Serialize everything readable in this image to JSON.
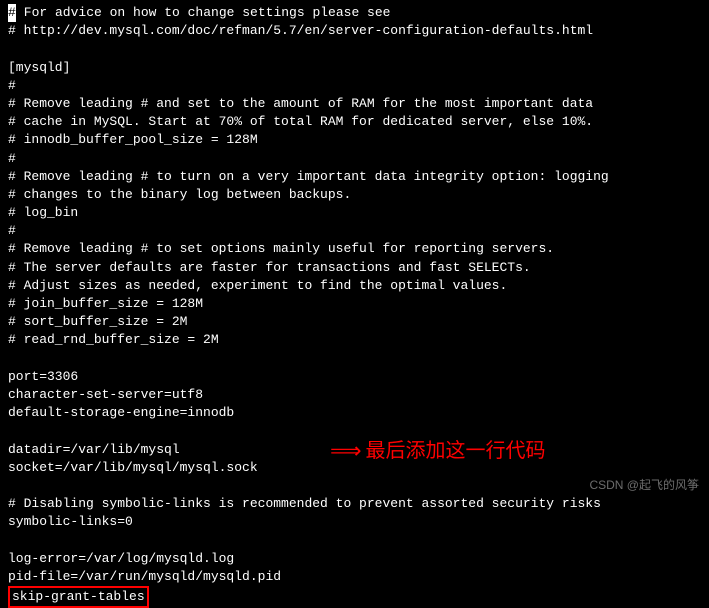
{
  "config_lines": [
    "# For advice on how to change settings please see",
    "# http://dev.mysql.com/doc/refman/5.7/en/server-configuration-defaults.html",
    "",
    "[mysqld]",
    "#",
    "# Remove leading # and set to the amount of RAM for the most important data",
    "# cache in MySQL. Start at 70% of total RAM for dedicated server, else 10%.",
    "# innodb_buffer_pool_size = 128M",
    "#",
    "# Remove leading # to turn on a very important data integrity option: logging",
    "# changes to the binary log between backups.",
    "# log_bin",
    "#",
    "# Remove leading # to set options mainly useful for reporting servers.",
    "# The server defaults are faster for transactions and fast SELECTs.",
    "# Adjust sizes as needed, experiment to find the optimal values.",
    "# join_buffer_size = 128M",
    "# sort_buffer_size = 2M",
    "# read_rnd_buffer_size = 2M",
    "",
    "port=3306",
    "character-set-server=utf8",
    "default-storage-engine=innodb",
    "",
    "datadir=/var/lib/mysql",
    "socket=/var/lib/mysql/mysql.sock",
    "",
    "# Disabling symbolic-links is recommended to prevent assorted security risks",
    "symbolic-links=0",
    "",
    "log-error=/var/log/mysqld.log",
    "pid-file=/var/run/mysqld/mysqld.pid"
  ],
  "highlighted_line": "skip-grant-tables",
  "cursor_char": "#",
  "annotation_text": "最后添加这一行代码",
  "watermark": "CSDN @起飞的风筝"
}
